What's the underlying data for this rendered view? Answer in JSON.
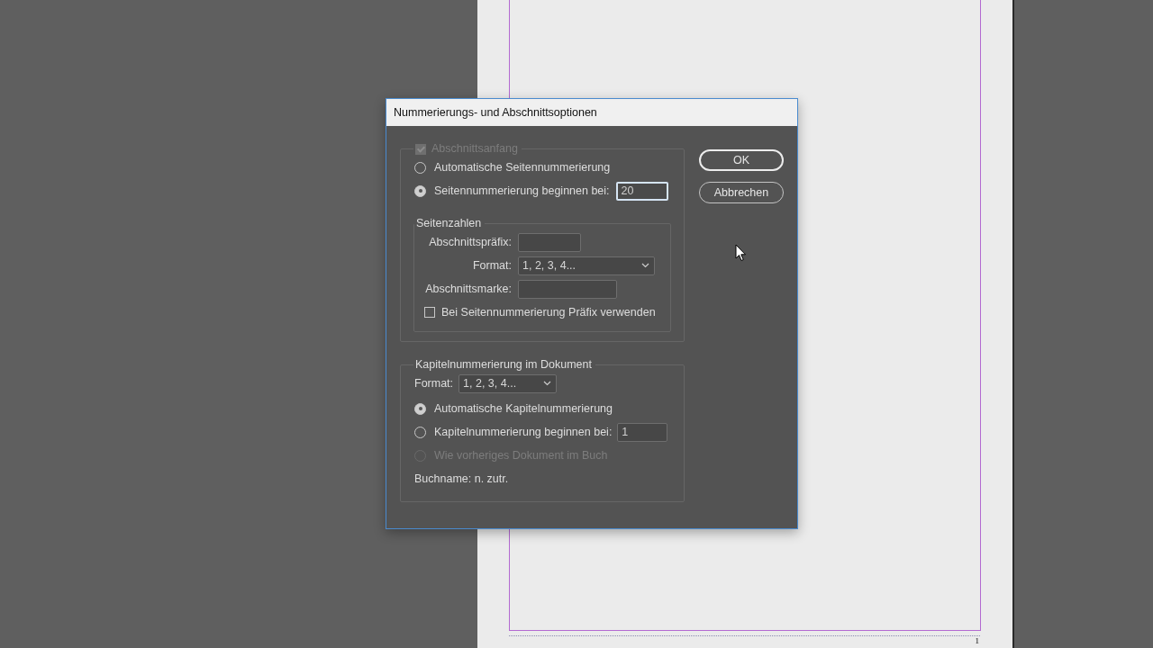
{
  "document": {
    "page_number": "1"
  },
  "window": {
    "title": "Nummerierungs- und Abschnittsoptionen"
  },
  "section_start": {
    "label": "Abschnittsanfang",
    "checked": true,
    "disabled": true,
    "options": [
      {
        "label": "Automatische Seitennummerierung",
        "selected": false
      },
      {
        "label": "Seitennummerierung beginnen bei:",
        "selected": true,
        "value": "20",
        "focused": true
      }
    ],
    "page_numbers": {
      "title": "Seitenzahlen",
      "fields": [
        {
          "kind": "text",
          "label": "Abschnittspräfix:"
        },
        {
          "kind": "select",
          "label": "Format:",
          "value": "1, 2, 3, 4..."
        },
        {
          "kind": "text",
          "label": "Abschnittsmarke:"
        }
      ],
      "prefix_option": {
        "label": "Bei Seitennummerierung Präfix verwenden",
        "checked": false
      }
    }
  },
  "chapter": {
    "title": "Kapitelnummerierung im Dokument",
    "format": {
      "label": "Format:",
      "value": "1, 2, 3, 4..."
    },
    "options": [
      {
        "label": "Automatische Kapitelnummerierung",
        "selected": true,
        "disabled": false
      },
      {
        "label": "Kapitelnummerierung beginnen bei:",
        "selected": false,
        "disabled": false,
        "value": "1"
      },
      {
        "label": "Wie vorheriges Dokument im Buch",
        "selected": false,
        "disabled": true
      }
    ],
    "book_name": "Buchname: n. zutr."
  },
  "buttons": [
    {
      "label": "OK",
      "default": true
    },
    {
      "label": "Abbrechen",
      "default": false
    }
  ]
}
